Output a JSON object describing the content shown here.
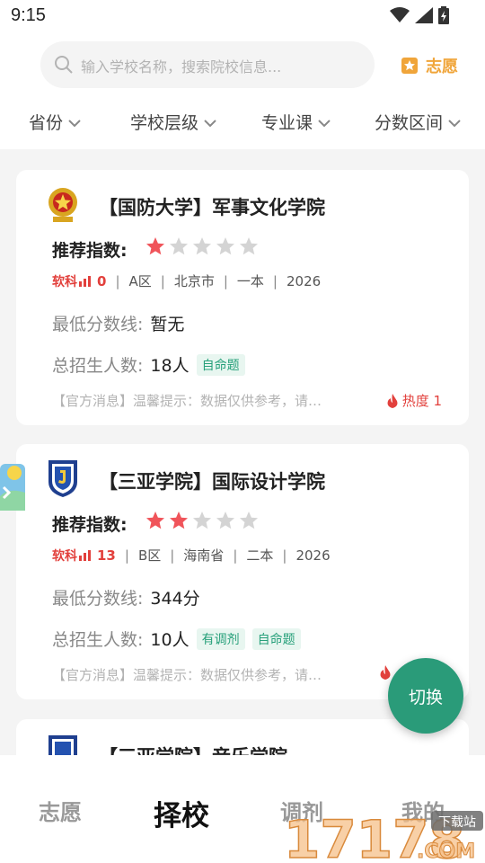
{
  "status": {
    "time": "9:15"
  },
  "search": {
    "placeholder": "输入学校名称，搜索院校信息..."
  },
  "header": {
    "wish_label": "志愿"
  },
  "filters": [
    "省份",
    "学校层级",
    "专业课",
    "分数区间"
  ],
  "cards": [
    {
      "name": "【国防大学】军事文化学院",
      "rec_label": "推荐指数:",
      "stars": 1,
      "brand": "软科",
      "rank": "0",
      "zone": "A区",
      "city": "北京市",
      "tier": "一本",
      "year": "2026",
      "min_score_label": "最低分数线:",
      "min_score": "暂无",
      "enroll_label": "总招生人数:",
      "enroll": "18人",
      "tags": [
        "自命题"
      ],
      "notice": "【官方消息】温馨提示：数据仅供参考，请…",
      "heat": "热度 1"
    },
    {
      "name": "【三亚学院】国际设计学院",
      "rec_label": "推荐指数:",
      "stars": 2,
      "brand": "软科",
      "rank": "13",
      "zone": "B区",
      "city": "海南省",
      "tier": "二本",
      "year": "2026",
      "min_score_label": "最低分数线:",
      "min_score": "344分",
      "enroll_label": "总招生人数:",
      "enroll": "10人",
      "tags": [
        "有调剂",
        "自命题"
      ],
      "notice": "【官方消息】温馨提示：数据仅供参考，请…"
    },
    {
      "name": "【三亚学院】音乐学院"
    }
  ],
  "fab": {
    "label": "切换"
  },
  "tabs": [
    "志愿",
    "择校",
    "调剂",
    "我的"
  ],
  "watermark": {
    "text": "17178",
    "suffix": ".COM",
    "badge": "下载站"
  },
  "colors": {
    "accent": "#2a9b79",
    "star_active": "#f0545a",
    "star_inactive": "#d4d4d4",
    "hot": "#e2403c",
    "wish": "#f0a53a"
  }
}
